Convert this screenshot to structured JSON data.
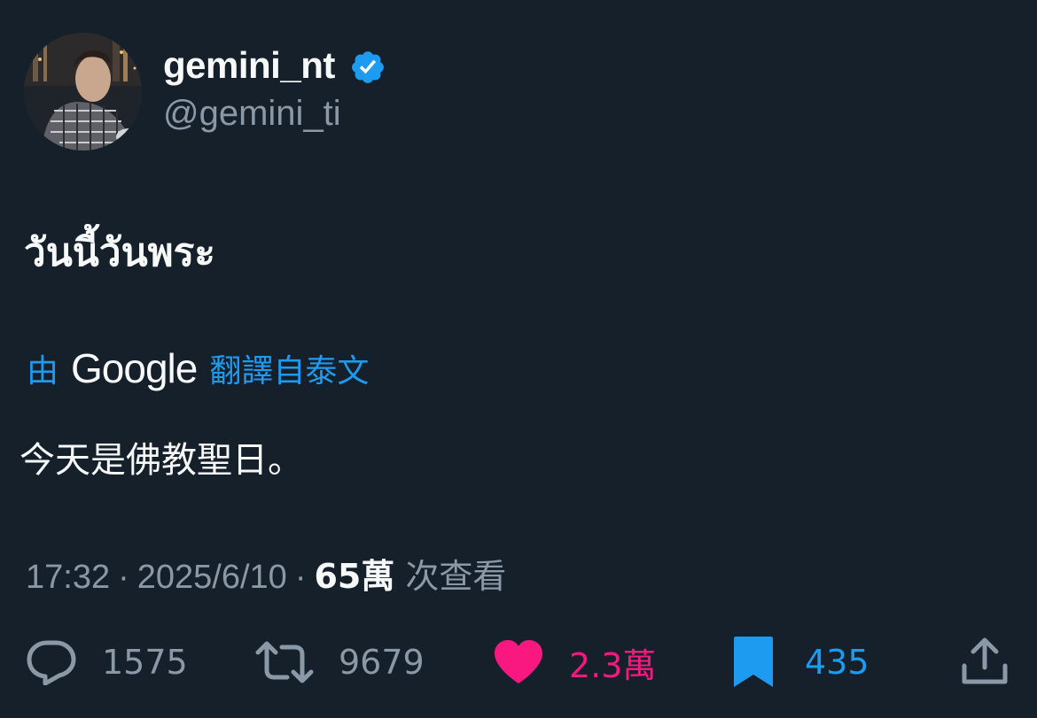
{
  "author": {
    "display_name": "gemini_nt",
    "handle": "@gemini_ti",
    "verified": true,
    "verified_color": "#1d9bf0"
  },
  "tweet": {
    "text": "วันนี้วันพระ",
    "translation": {
      "prefix": "由",
      "brand": "Google",
      "suffix": "翻譯自泰文",
      "text": "今天是佛教聖日。"
    }
  },
  "meta": {
    "time": "17:32",
    "separator": "·",
    "date": "2025/6/10",
    "views": "65萬",
    "views_label": "次查看"
  },
  "actions": {
    "reply": {
      "icon": "reply-icon",
      "count": "1575"
    },
    "retweet": {
      "icon": "retweet-icon",
      "count": "9679"
    },
    "like": {
      "icon": "heart-icon",
      "count": "2.3萬",
      "color": "#f91880"
    },
    "bookmark": {
      "icon": "bookmark-icon",
      "count": "435",
      "color": "#1d9bf0"
    },
    "share": {
      "icon": "share-icon"
    }
  },
  "colors": {
    "background": "#15202b",
    "text": "#f7f9f9",
    "secondary": "#8b98a5",
    "accent": "#1d9bf0"
  }
}
